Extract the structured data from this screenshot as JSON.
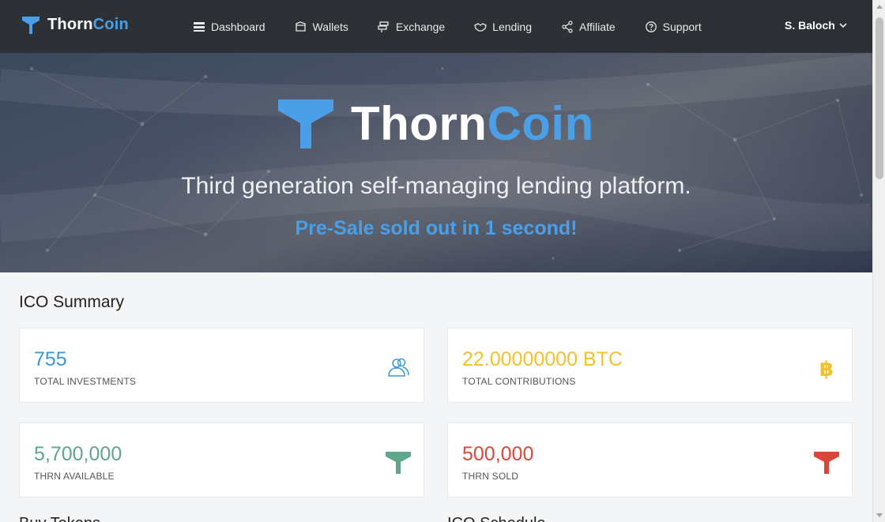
{
  "brand": {
    "name_part1": "Thorn",
    "name_part2": "Coin",
    "accent": "#4a9fe6"
  },
  "nav": {
    "items": [
      {
        "label": "Dashboard",
        "icon": "dashboard-icon"
      },
      {
        "label": "Wallets",
        "icon": "wallet-icon"
      },
      {
        "label": "Exchange",
        "icon": "exchange-icon"
      },
      {
        "label": "Lending",
        "icon": "handshake-icon"
      },
      {
        "label": "Affiliate",
        "icon": "share-icon"
      },
      {
        "label": "Support",
        "icon": "help-icon"
      }
    ],
    "user": "S. Baloch"
  },
  "hero": {
    "title_part1": "Thorn",
    "title_part2": "Coin",
    "subtitle": "Third generation self-managing lending platform.",
    "tagline": "Pre-Sale sold out in 1 second!"
  },
  "summary": {
    "title": "ICO Summary",
    "cards": [
      {
        "value": "755",
        "label": "TOTAL INVESTMENTS",
        "color": "#3b98d8",
        "icon": "users-icon"
      },
      {
        "value": "22.00000000 BTC",
        "label": "TOTAL CONTRIBUTIONS",
        "color": "#f2c12e",
        "icon": "bitcoin-icon"
      },
      {
        "value": "5,700,000",
        "label": "THRN AVAILABLE",
        "color": "#5fa68a",
        "icon": "thorncoin-icon"
      },
      {
        "value": "500,000",
        "label": "THRN SOLD",
        "color": "#d9473a",
        "icon": "thorncoin-icon"
      }
    ]
  },
  "below_fold": {
    "left_heading": "Buy Tokens",
    "right_heading": "ICO Schedule"
  }
}
